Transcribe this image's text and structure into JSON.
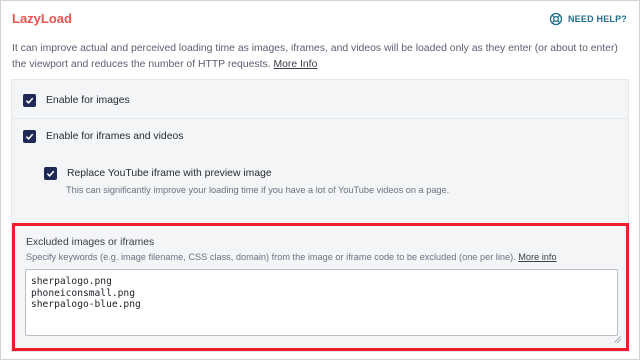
{
  "header": {
    "title": "LazyLoad",
    "help_label": "NEED HELP?",
    "help_icon": "lifebuoy-icon",
    "accent_color": "#e8554e"
  },
  "intro": {
    "text": "It can improve actual and perceived loading time as images, iframes, and videos will be loaded only as they enter (or about to enter) the viewport and reduces the number of HTTP requests. ",
    "link": "More Info"
  },
  "options": [
    {
      "label": "Enable for images",
      "checked": true
    },
    {
      "label": "Enable for iframes and videos",
      "checked": true
    },
    {
      "label": "Replace YouTube iframe with preview image",
      "checked": true,
      "hint": "This can significantly improve your loading time if you have a lot of YouTube videos on a page."
    }
  ],
  "exclusions": {
    "title": "Excluded images or iframes",
    "hint": "Specify keywords (e.g. image filename, CSS class, domain) from the image or iframe code to be excluded (one per line). ",
    "link": "More info",
    "value": "sherpalogo.png\nphoneiconsmall.png\nsherpalogo-blue.png",
    "highlight_color": "#ee1d2b"
  }
}
